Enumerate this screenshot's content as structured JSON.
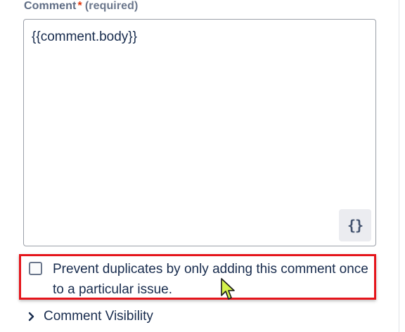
{
  "field": {
    "label": "Comment",
    "required_star": "*",
    "required_text": "(required)",
    "value": "{{comment.body}}",
    "smart_values_button": "{}"
  },
  "options": {
    "prevent_duplicates": {
      "label": "Prevent duplicates by only adding this comment once to a particular issue.",
      "checked": false
    }
  },
  "sections": {
    "comment_visibility": {
      "label": "Comment Visibility",
      "expanded": false
    }
  },
  "colors": {
    "highlight": "#e5151b",
    "text": "#172b4d",
    "label": "#5e6c84",
    "required": "#de350b",
    "cursor": "#d4f24c"
  }
}
